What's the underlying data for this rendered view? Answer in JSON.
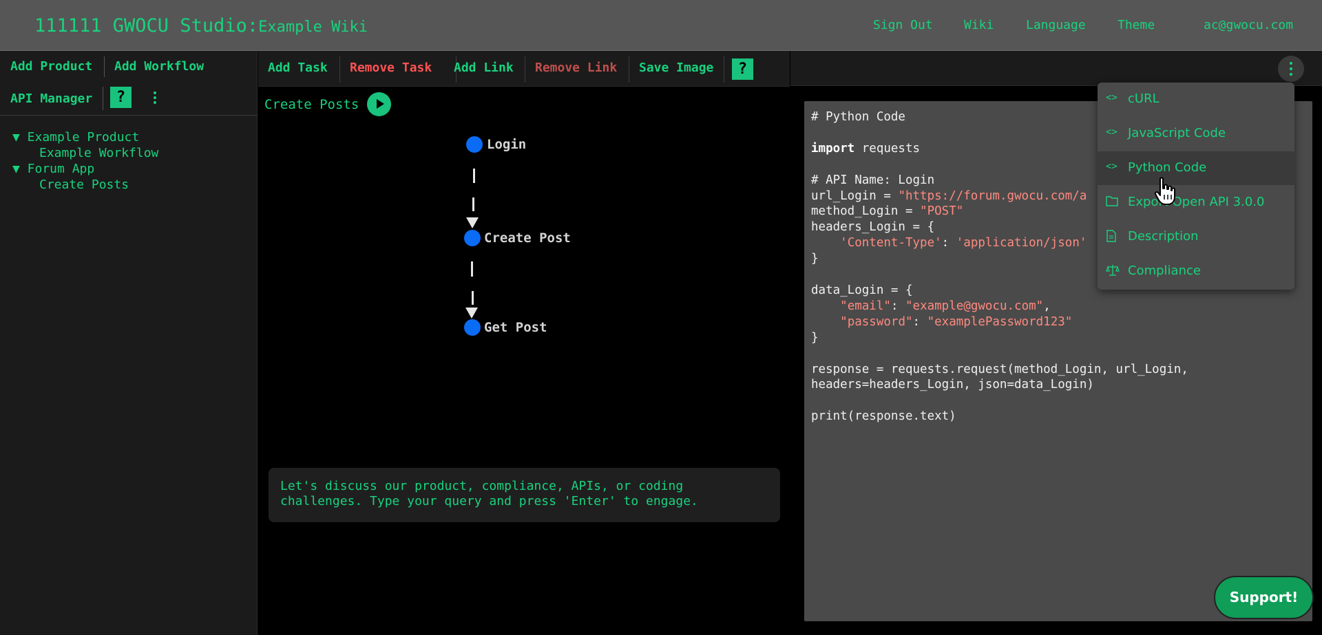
{
  "header": {
    "brand": "111111 GWOCU Studio:",
    "brand_sub": "Example Wiki",
    "nav": [
      "Sign Out",
      "Wiki",
      "Language",
      "Theme",
      "ac@gwocu.com"
    ]
  },
  "sidebar": {
    "tools": [
      "Add Product",
      "Add Workflow",
      "API Manager"
    ],
    "help": "?",
    "tree": [
      {
        "label": "▼ Example Product"
      },
      {
        "label": "Example Workflow"
      },
      {
        "label": "▼ Forum App"
      },
      {
        "label": "Create Posts"
      }
    ]
  },
  "center": {
    "toolbar": [
      {
        "label": "Add Task",
        "color": "#19d27e"
      },
      {
        "label": "Remove Task",
        "color": "#ff5252"
      },
      {
        "label": "Add Link",
        "color": "#19d27e"
      },
      {
        "label": "Remove Link",
        "color": "#c0504d"
      },
      {
        "label": "Save Image",
        "color": "#19d27e"
      }
    ],
    "help": "?",
    "workflow_title": "Create Posts",
    "nodes": [
      "Login",
      "Create Post",
      "Get Post"
    ],
    "node_color": "#0a6cf5",
    "chat_message": "Let's discuss our product, compliance, APIs, or coding challenges. Type your query and press 'Enter' to engage."
  },
  "code": {
    "lines": [
      [
        {
          "t": "# Python Code"
        }
      ],
      [],
      [
        {
          "t": "import",
          "c": "kw"
        },
        {
          "t": " requests"
        }
      ],
      [],
      [
        {
          "t": "# API Name: Login"
        }
      ],
      [
        {
          "t": "url_Login = "
        },
        {
          "t": "\"https://forum.gwocu.com/a",
          "c": "str"
        }
      ],
      [
        {
          "t": "method_Login = "
        },
        {
          "t": "\"POST\"",
          "c": "str"
        }
      ],
      [
        {
          "t": "headers_Login = {"
        }
      ],
      [
        {
          "t": "    "
        },
        {
          "t": "'Content-Type'",
          "c": "str"
        },
        {
          "t": ": "
        },
        {
          "t": "'application/json'",
          "c": "str"
        }
      ],
      [
        {
          "t": "}"
        }
      ],
      [],
      [
        {
          "t": "data_Login = {"
        }
      ],
      [
        {
          "t": "    "
        },
        {
          "t": "\"email\"",
          "c": "str"
        },
        {
          "t": ": "
        },
        {
          "t": "\"example@gwocu.com\"",
          "c": "str"
        },
        {
          "t": ","
        }
      ],
      [
        {
          "t": "    "
        },
        {
          "t": "\"password\"",
          "c": "str"
        },
        {
          "t": ": "
        },
        {
          "t": "\"examplePassword123\"",
          "c": "str"
        }
      ],
      [
        {
          "t": "}"
        }
      ],
      [],
      [
        {
          "t": "response = requests.request(method_Login, url_Login,"
        }
      ],
      [
        {
          "t": "headers=headers_Login, json=data_Login)"
        }
      ],
      [],
      [
        {
          "t": "print(response.text)"
        }
      ]
    ]
  },
  "dropdown": {
    "items": [
      {
        "label": "cURL",
        "icon": "code-icon",
        "glyph": "<>"
      },
      {
        "label": "JavaScript Code",
        "icon": "code-icon",
        "glyph": "<>"
      },
      {
        "label": "Python Code",
        "icon": "code-icon",
        "glyph": "<>",
        "active": true
      },
      {
        "label": "Export Open API 3.0.0",
        "icon": "folder-icon",
        "glyph": ""
      },
      {
        "label": "Description",
        "icon": "file-icon",
        "glyph": ""
      },
      {
        "label": "Compliance",
        "icon": "scale-icon",
        "glyph": ""
      }
    ]
  },
  "support": {
    "label": "Support!"
  }
}
